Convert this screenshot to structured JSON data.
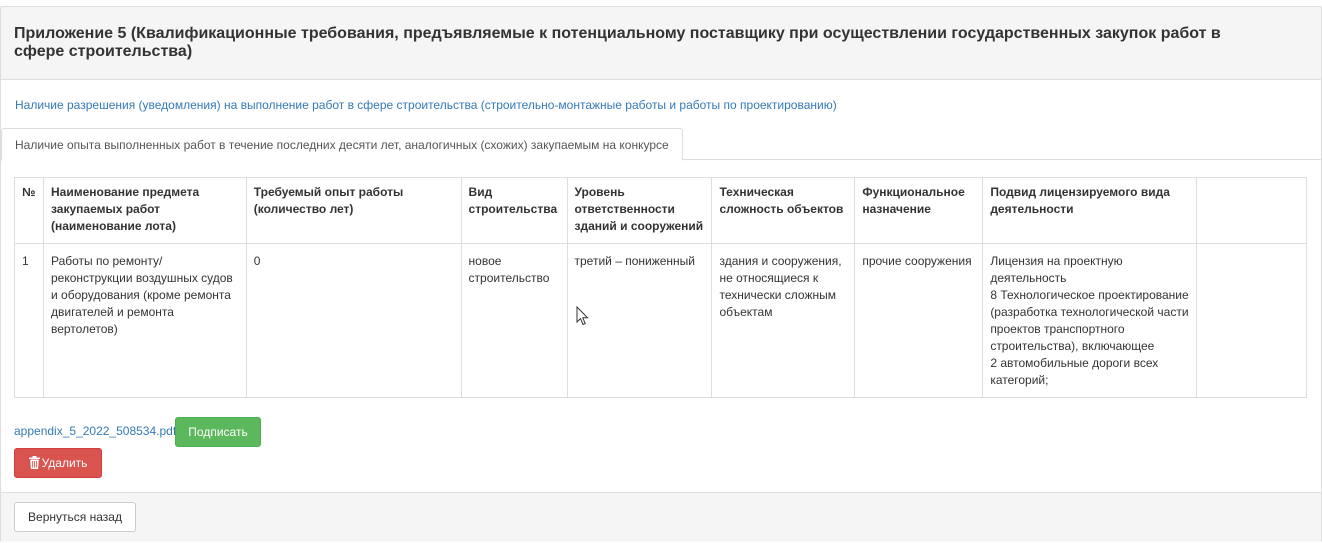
{
  "panel": {
    "title": "Приложение 5 (Квалификационные требования, предъявляемые к потенциальному поставщику при осуществлении государственных закупок работ в сфере строительства)"
  },
  "permission_link": "Наличие разрешения (уведомления) на выполнение работ в сфере строительства (строительно-монтажные работы и работы по проектированию)",
  "tabs": [
    {
      "label": "Наличие опыта выполненных работ в течение последних десяти лет, аналогичных (схожих) закупаемым на конкурсе",
      "active": true
    }
  ],
  "table": {
    "headers": [
      "№",
      "Наименование предмета закупаемых работ (наименование лота)",
      "Требуемый опыт работы (количество лет)",
      "Вид строительства",
      "Уровень ответственности зданий и сооружений",
      "Техническая сложность объектов",
      "Функциональное назначение",
      "Подвид лицензируемого вида деятельности",
      ""
    ],
    "rows": [
      {
        "num": "1",
        "name": "Работы по ремонту/ реконструкции воздушных судов и оборудования (кроме ремонта двигателей и ремонта вертолетов)",
        "experience": "0",
        "construction_type": "новое строительство",
        "responsibility": "третий – пониженный",
        "complexity": "здания и сооружения, не относящиеся к технически сложным объектам",
        "purpose": "прочие сооружения",
        "license_lines": [
          "Лицензия на проектную деятельность",
          "8 Технологическое проектирование (разработка технологической части проектов транспортного строительства), включающее",
          "2 автомобильные дороги всех категорий;"
        ],
        "extra": ""
      }
    ]
  },
  "file": {
    "name": "appendix_5_2022_508534.pdf"
  },
  "buttons": {
    "sign": "Подписать",
    "delete": "Удалить",
    "back": "Вернуться назад"
  },
  "icons": {
    "delete": "trash-icon",
    "cursor": "mouse-pointer-icon"
  },
  "colors": {
    "link": "#337ab7",
    "sign_button": "#5cb85c",
    "delete_button": "#d9534f",
    "panel_bg": "#f5f5f5",
    "border": "#dddddd"
  }
}
